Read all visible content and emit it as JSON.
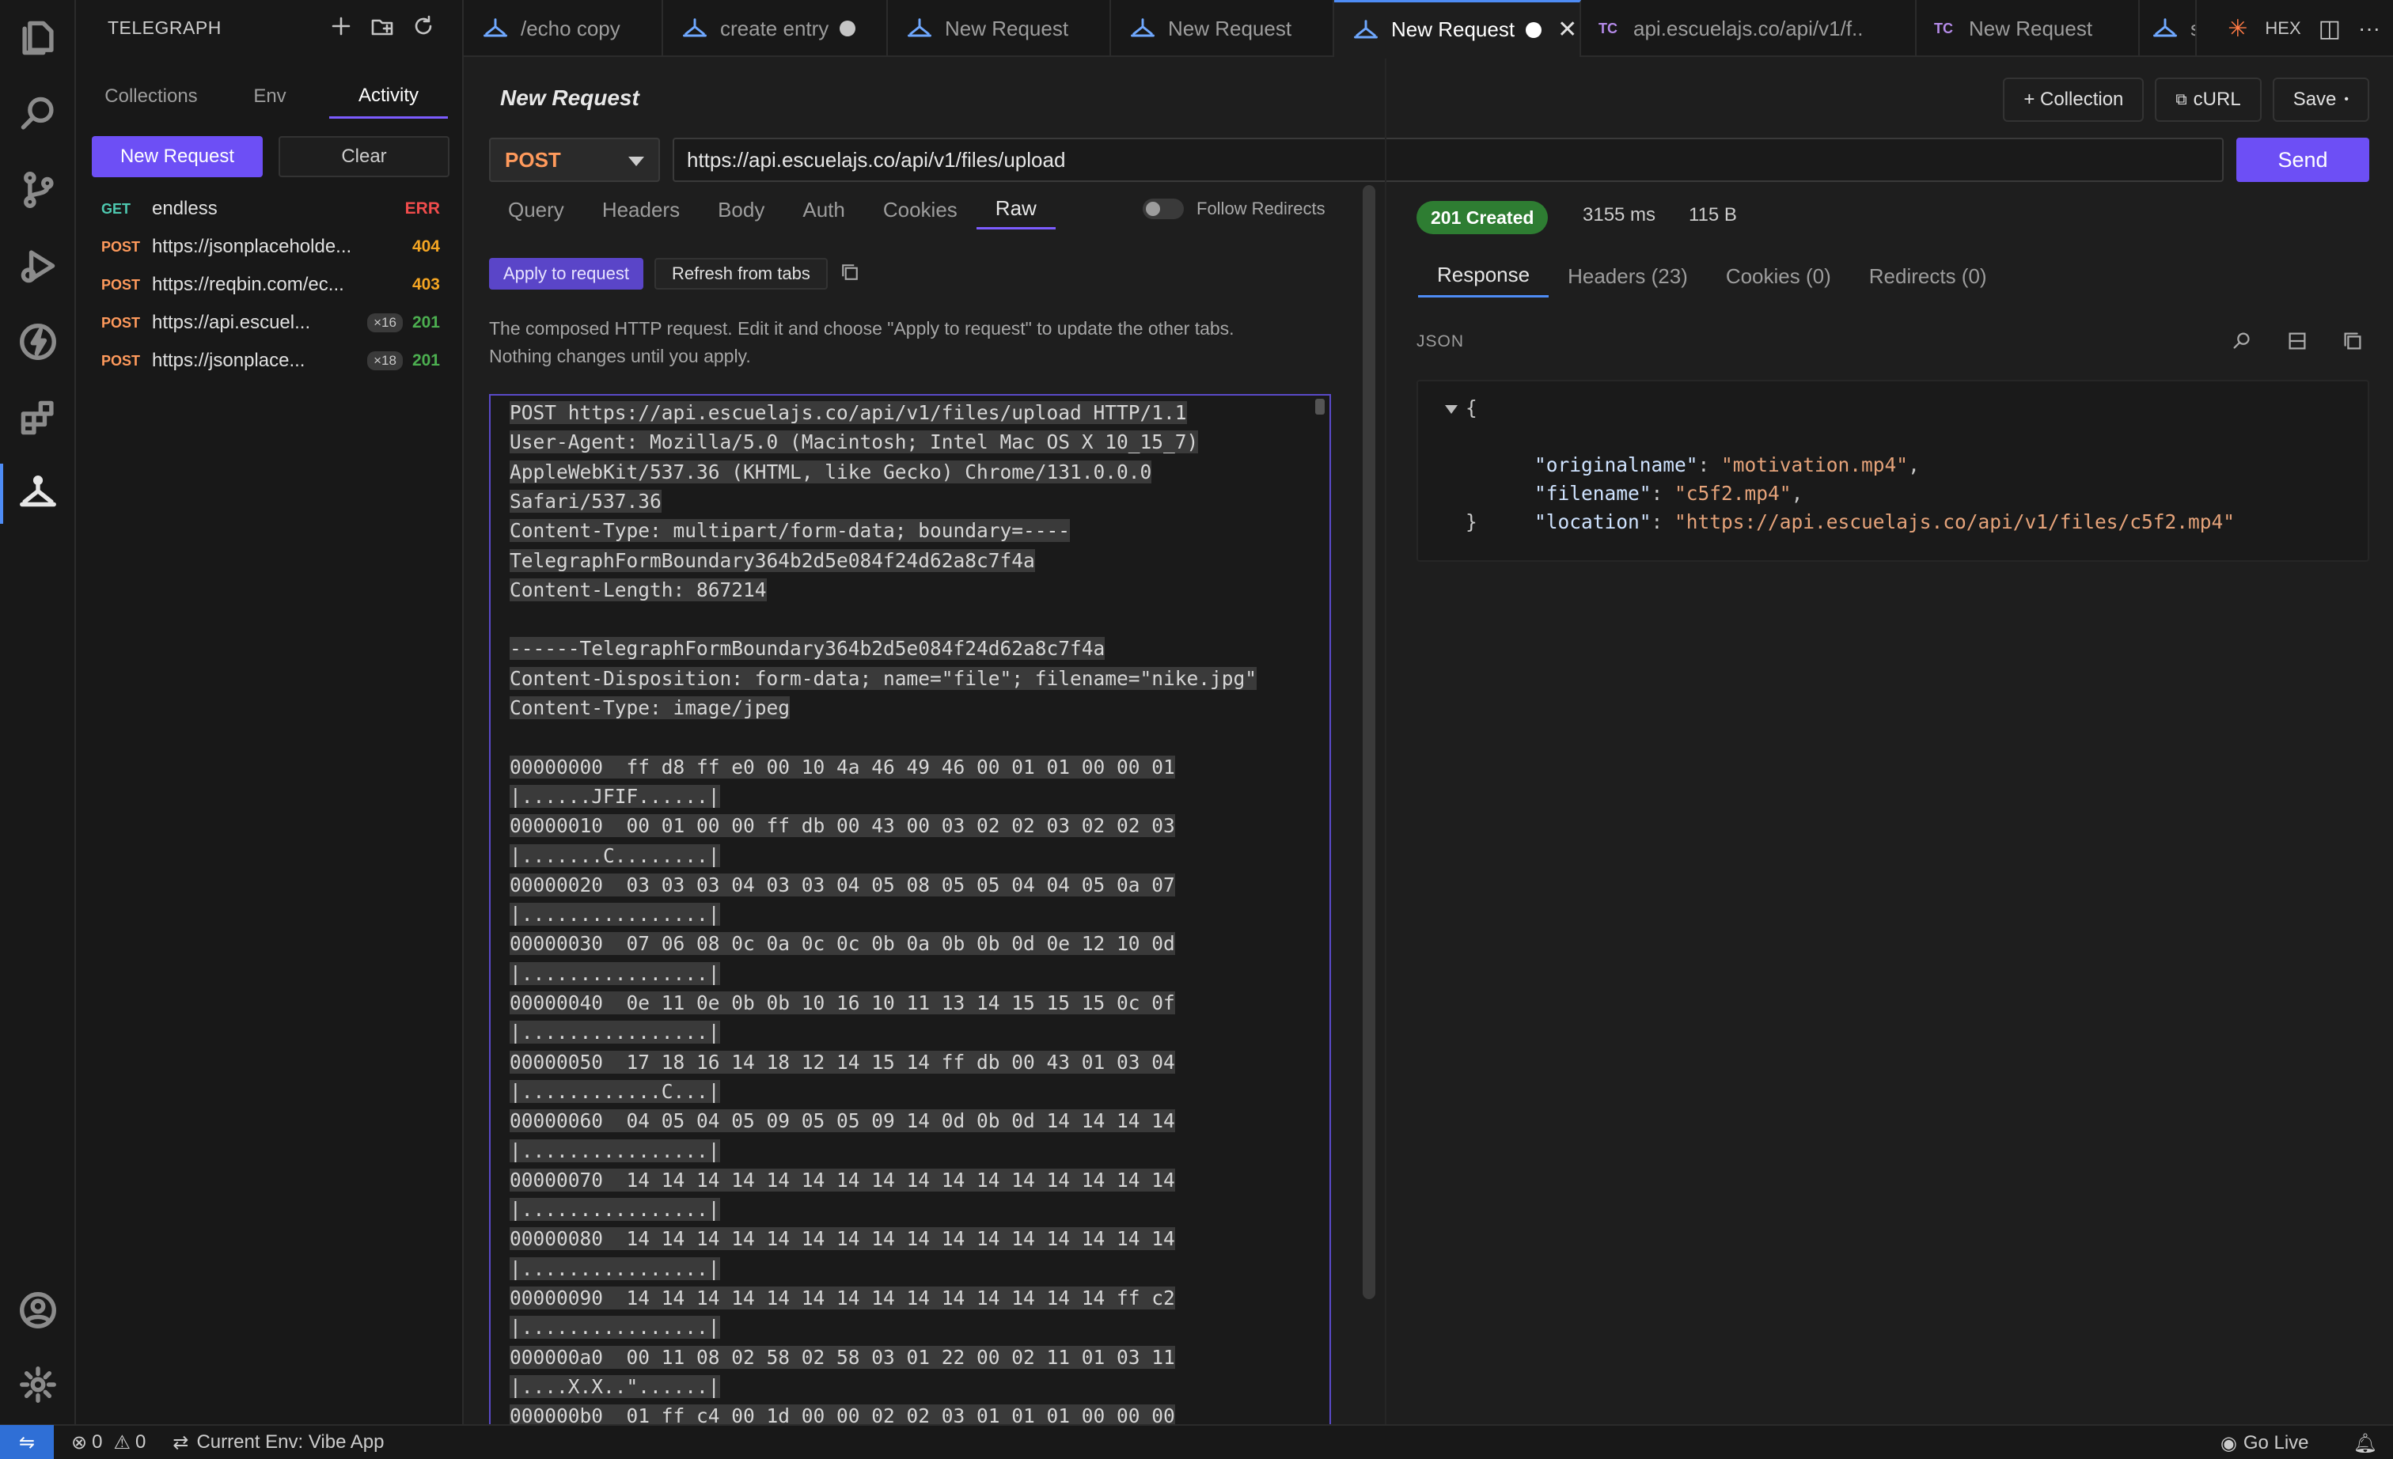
{
  "sidebar": {
    "title": "TELEGRAPH",
    "tabs": [
      "Collections",
      "Env",
      "Activity"
    ],
    "active_tab": "Activity",
    "new_request_label": "New Request",
    "clear_label": "Clear",
    "history": [
      {
        "method": "GET",
        "url": "endless",
        "code": "ERR",
        "count": ""
      },
      {
        "method": "POST",
        "url": "https://jsonplaceholde...",
        "code": "404",
        "count": ""
      },
      {
        "method": "POST",
        "url": "https://reqbin.com/ec...",
        "code": "403",
        "count": ""
      },
      {
        "method": "POST",
        "url": "https://api.escuel...",
        "code": "201",
        "count": "×16"
      },
      {
        "method": "POST",
        "url": "https://jsonplace...",
        "code": "201",
        "count": "×18"
      }
    ]
  },
  "tabs": [
    {
      "label": "/echo copy",
      "kind": "telegraph"
    },
    {
      "label": "create entry",
      "kind": "telegraph",
      "dirty": true
    },
    {
      "label": "New Request",
      "kind": "telegraph"
    },
    {
      "label": "New Request",
      "kind": "telegraph"
    },
    {
      "label": "New Request",
      "kind": "telegraph",
      "dirty": true,
      "active": true
    },
    {
      "label": "api.escuelajs.co/api/v1/f..",
      "kind": "tc"
    },
    {
      "label": "New Request",
      "kind": "tc"
    },
    {
      "label": "s",
      "kind": "telegraph"
    }
  ],
  "tc_badge": "TC",
  "editor_actions": {
    "hex": "HEX",
    "more": "···"
  },
  "request": {
    "title": "New Request",
    "collection_btn": "+ Collection",
    "curl_btn": "cURL",
    "save_btn": "Save",
    "method": "POST",
    "url": "https://api.escuelajs.co/api/v1/files/upload",
    "send_label": "Send",
    "tabs": [
      "Query",
      "Headers",
      "Body",
      "Auth",
      "Cookies",
      "Raw"
    ],
    "active_tab": "Raw",
    "follow_redirects_label": "Follow Redirects",
    "apply_label": "Apply to request",
    "refresh_label": "Refresh from tabs",
    "description_1": "The composed HTTP request. Edit it and choose \"Apply to request\" to update the other tabs.",
    "description_2": "Nothing changes until you apply.",
    "raw_lines": [
      "POST https://api.escuelajs.co/api/v1/files/upload HTTP/1.1",
      "User-Agent: Mozilla/5.0 (Macintosh; Intel Mac OS X 10_15_7)",
      "AppleWebKit/537.36 (KHTML, like Gecko) Chrome/131.0.0.0",
      "Safari/537.36",
      "Content-Type: multipart/form-data; boundary=----",
      "TelegraphFormBoundary364b2d5e084f24d62a8c7f4a",
      "Content-Length: 867214",
      "",
      "------TelegraphFormBoundary364b2d5e084f24d62a8c7f4a",
      "Content-Disposition: form-data; name=\"file\"; filename=\"nike.jpg\"",
      "Content-Type: image/jpeg",
      "",
      "00000000  ff d8 ff e0 00 10 4a 46 49 46 00 01 01 00 00 01",
      "|......JFIF......|",
      "00000010  00 01 00 00 ff db 00 43 00 03 02 02 03 02 02 03",
      "|.......C........|",
      "00000020  03 03 03 04 03 03 04 05 08 05 05 04 04 05 0a 07",
      "|................|",
      "00000030  07 06 08 0c 0a 0c 0c 0b 0a 0b 0b 0d 0e 12 10 0d",
      "|................|",
      "00000040  0e 11 0e 0b 0b 10 16 10 11 13 14 15 15 15 0c 0f",
      "|................|",
      "00000050  17 18 16 14 18 12 14 15 14 ff db 00 43 01 03 04",
      "|............C...|",
      "00000060  04 05 04 05 09 05 05 09 14 0d 0b 0d 14 14 14 14",
      "|................|",
      "00000070  14 14 14 14 14 14 14 14 14 14 14 14 14 14 14 14",
      "|................|",
      "00000080  14 14 14 14 14 14 14 14 14 14 14 14 14 14 14 14",
      "|................|",
      "00000090  14 14 14 14 14 14 14 14 14 14 14 14 14 14 ff c2",
      "|................|",
      "000000a0  00 11 08 02 58 02 58 03 01 22 00 02 11 01 03 11",
      "|....X.X..\"......|",
      "000000b0  01 ff c4 00 1d 00 00 02 02 03 01 01 01 00 00 00",
      "|................|"
    ]
  },
  "response": {
    "status": "201 Created",
    "time": "3155 ms",
    "size": "115 B",
    "tabs": [
      "Response",
      "Headers (23)",
      "Cookies (0)",
      "Redirects (0)"
    ],
    "active_tab": "Response",
    "format_label": "JSON",
    "json": {
      "open": "{",
      "close": "}",
      "fields": [
        {
          "key": "\"originalname\"",
          "value": "\"motivation.mp4\"",
          "comma": ","
        },
        {
          "key": "\"filename\"",
          "value": "\"c5f2.mp4\"",
          "comma": ","
        },
        {
          "key": "\"location\"",
          "value": "\"https://api.escuelajs.co/api/v1/files/c5f2.mp4\"",
          "comma": ""
        }
      ]
    }
  },
  "statusbar": {
    "errors": "0",
    "warnings": "0",
    "env": "Current Env: Vibe App",
    "go_live": "Go Live"
  },
  "colors": {
    "accent": "#6d4ff5",
    "method_post": "#ff9a5c",
    "method_get": "#4ec9b0",
    "code_err": "#f14c4c",
    "code_4xx": "#f5a623",
    "code_2xx": "#4caf50",
    "status_ok": "#2e7d32"
  }
}
